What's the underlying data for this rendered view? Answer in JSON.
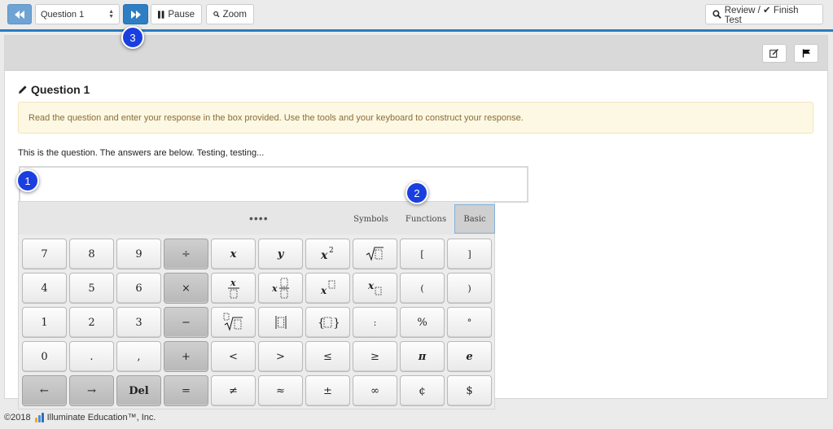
{
  "toolbar": {
    "question_select": "Question 1",
    "pause_label": "Pause",
    "zoom_label": "Zoom",
    "review_label": "Review / ✔ Finish Test"
  },
  "bubbles": {
    "b1": "1",
    "b2": "2",
    "b3": "3"
  },
  "question": {
    "title": "Question 1",
    "instructions": "Read the question and enter your response in the box provided. Use the tools and your keyboard to construct your response.",
    "text": "This is the question. The answers are below. Testing, testing..."
  },
  "keyboard": {
    "dots": "••••",
    "tabs": {
      "symbols": "Symbols",
      "functions": "Functions",
      "basic": "Basic"
    },
    "active_tab": "Basic",
    "keys": {
      "k7": "7",
      "k8": "8",
      "k9": "9",
      "div": "÷",
      "x": "x",
      "y": "y",
      "lbracket": "[",
      "rbracket": "]",
      "k4": "4",
      "k5": "5",
      "k6": "6",
      "times": "×",
      "lparen": "(",
      "rparen": ")",
      "k1": "1",
      "k2": "2",
      "k3": "3",
      "minus": "−",
      "colon": ":",
      "percent": "%",
      "degree": "°",
      "k0": "0",
      "dot": ".",
      "comma": ",",
      "plus": "+",
      "lt": "<",
      "gt": ">",
      "le": "≤",
      "ge": "≥",
      "pi": "π",
      "e": "e",
      "left": "←",
      "right": "→",
      "del": "Del",
      "eq": "=",
      "ne": "≠",
      "approx": "≈",
      "pm": "±",
      "inf": "∞",
      "cent": "¢",
      "dollar": "$"
    }
  },
  "footer": {
    "text": "©2018",
    "brand": "Illuminate Education™, Inc."
  },
  "colors": {
    "accent": "#2f7ec4",
    "bubble": "#1a3fe0",
    "alert_bg": "#fcf8e3",
    "alert_text": "#8a6d3b"
  }
}
